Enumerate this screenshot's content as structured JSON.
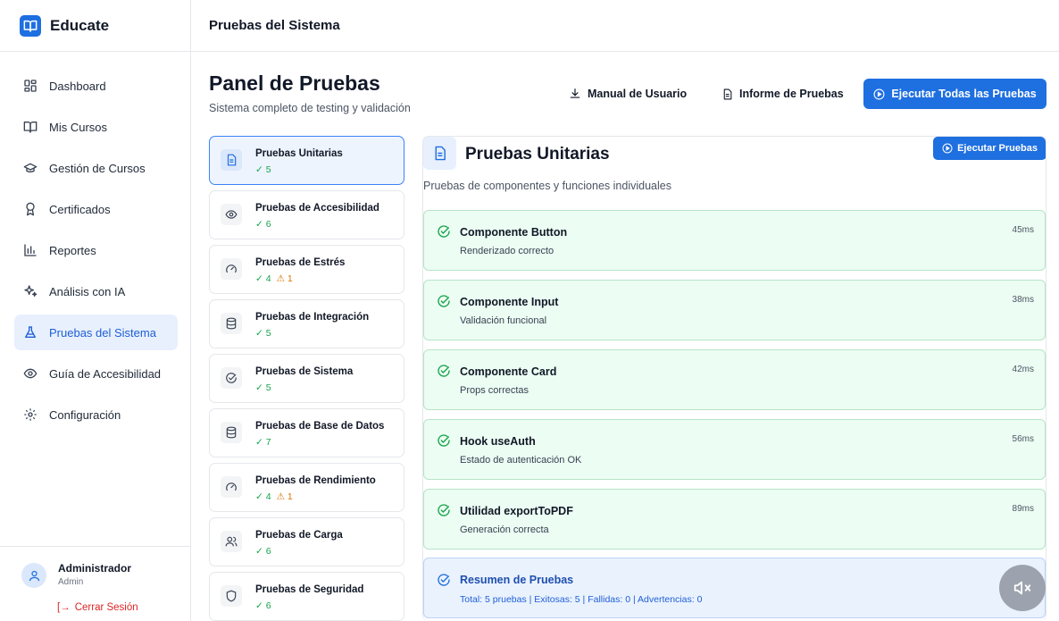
{
  "brand": {
    "name": "Educate",
    "logo_icon": "book-open-icon",
    "accent": "#1e6fe0"
  },
  "sidebar": {
    "items": [
      {
        "label": "Dashboard",
        "icon": "grid-icon"
      },
      {
        "label": "Mis Cursos",
        "icon": "book-open-icon"
      },
      {
        "label": "Gestión de Cursos",
        "icon": "graduation-cap-icon"
      },
      {
        "label": "Certificados",
        "icon": "award-icon"
      },
      {
        "label": "Reportes",
        "icon": "bar-chart-icon"
      },
      {
        "label": "Análisis con IA",
        "icon": "sparkles-icon"
      },
      {
        "label": "Pruebas del Sistema",
        "icon": "flask-icon",
        "active": true
      },
      {
        "label": "Guía de Accesibilidad",
        "icon": "eye-icon"
      },
      {
        "label": "Configuración",
        "icon": "gear-icon"
      }
    ],
    "user": {
      "name": "Administrador",
      "role": "Admin",
      "logout_label": "Cerrar Sesión"
    }
  },
  "header": {
    "title": "Pruebas del Sistema"
  },
  "page": {
    "title": "Panel de Pruebas",
    "subtitle": "Sistema completo de testing y validación",
    "manual_label": "Manual de Usuario",
    "report_label": "Informe de Pruebas",
    "run_all_label": "Ejecutar Todas las Pruebas"
  },
  "categories": [
    {
      "name": "Pruebas Unitarias",
      "passed": "✓ 5",
      "warnings": "",
      "icon": "file-text-icon",
      "active": true
    },
    {
      "name": "Pruebas de Accesibilidad",
      "passed": "✓ 6",
      "warnings": "",
      "icon": "eye-icon"
    },
    {
      "name": "Pruebas de Estrés",
      "passed": "✓ 4",
      "warnings": "⚠ 1",
      "icon": "gauge-icon"
    },
    {
      "name": "Pruebas de Integración",
      "passed": "✓ 5",
      "warnings": "",
      "icon": "database-icon"
    },
    {
      "name": "Pruebas de Sistema",
      "passed": "✓ 5",
      "warnings": "",
      "icon": "check-circle-icon"
    },
    {
      "name": "Pruebas de Base de Datos",
      "passed": "✓ 7",
      "warnings": "",
      "icon": "database-icon"
    },
    {
      "name": "Pruebas de Rendimiento",
      "passed": "✓ 4",
      "warnings": "⚠ 1",
      "icon": "gauge-icon"
    },
    {
      "name": "Pruebas de Carga",
      "passed": "✓ 6",
      "warnings": "",
      "icon": "users-icon"
    },
    {
      "name": "Pruebas de Seguridad",
      "passed": "✓ 6",
      "warnings": "",
      "icon": "shield-icon"
    }
  ],
  "detail": {
    "title": "Pruebas Unitarias",
    "subtitle": "Pruebas de componentes y funciones individuales",
    "run_label": "Ejecutar Pruebas",
    "results": [
      {
        "name": "Componente Button",
        "desc": "Renderizado correcto",
        "time": "45ms"
      },
      {
        "name": "Componente Input",
        "desc": "Validación funcional",
        "time": "38ms"
      },
      {
        "name": "Componente Card",
        "desc": "Props correctas",
        "time": "42ms"
      },
      {
        "name": "Hook useAuth",
        "desc": "Estado de autenticación OK",
        "time": "56ms"
      },
      {
        "name": "Utilidad exportToPDF",
        "desc": "Generación correcta",
        "time": "89ms"
      }
    ],
    "summary": {
      "title": "Resumen de Pruebas",
      "text": "Total: 5 pruebas | Exitosas: 5 | Fallidas: 0 | Advertencias: 0"
    }
  },
  "mute_icon": "volume-x-icon"
}
